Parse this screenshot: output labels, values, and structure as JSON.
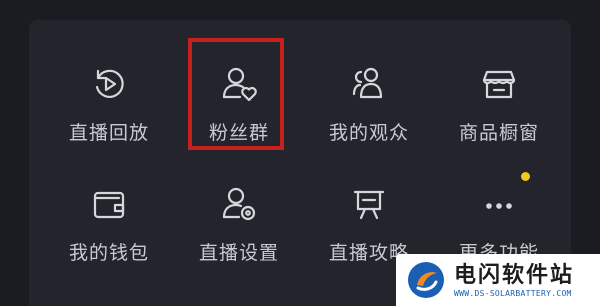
{
  "menu": {
    "items": [
      {
        "label": "直播回放",
        "icon": "replay-icon"
      },
      {
        "label": "粉丝群",
        "icon": "fan-group-icon"
      },
      {
        "label": "我的观众",
        "icon": "audience-icon"
      },
      {
        "label": "商品橱窗",
        "icon": "shop-window-icon"
      },
      {
        "label": "我的钱包",
        "icon": "wallet-icon"
      },
      {
        "label": "直播设置",
        "icon": "live-settings-icon"
      },
      {
        "label": "直播攻略",
        "icon": "live-guide-icon"
      },
      {
        "label": "更多功能",
        "icon": "more-icon"
      }
    ]
  },
  "colors": {
    "background": "#1b1b22",
    "panel": "#24252c",
    "text": "#c9cad1",
    "highlight": "#c81f1f",
    "badge": "#f3c91a"
  },
  "watermark": {
    "title": "电闪软件站",
    "url": "WWW.DS-SOLARBATTERY.COM"
  }
}
